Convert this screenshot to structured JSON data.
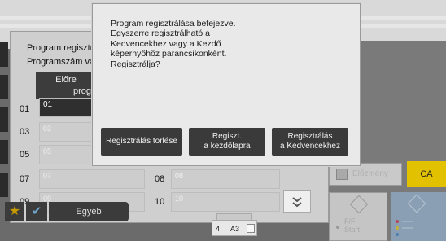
{
  "main_dialog": {
    "title_line1": "Program regisztr",
    "title_line2": "Programszám vá",
    "tab_label_line1": "Előre",
    "tab_label_line2": "prog",
    "programs": [
      {
        "number": "01",
        "field": "01"
      },
      {
        "number": "03",
        "field": "03"
      },
      {
        "number": "05",
        "field": "05"
      },
      {
        "number": "07",
        "field": "07"
      },
      {
        "number": "08",
        "field": "08"
      },
      {
        "number": "09",
        "field": "09"
      },
      {
        "number": "10",
        "field": "10"
      }
    ],
    "scroll_down_icon": "double-chevron-down-icon"
  },
  "popup": {
    "message": "Program regisztrálása befejezve.\nEgyszerre regisztrálható a\nKedvencekhez vagy a Kezdő\nképernyőhöz parancsikonként.\nRegisztrálja?",
    "buttons": {
      "cancel": "Regisztrálás törlése",
      "home": "Regiszt.\na kezdőlapra",
      "favorites": "Regisztrálás\na Kedvencekhez"
    }
  },
  "right_panel": {
    "address_label": "Előzmény",
    "ca_label": "CA",
    "bw_start_line1": "F/F",
    "bw_start_line2": "Start"
  },
  "bottom_bar": {
    "star_icon": "star-icon",
    "check_icon": "checkmark-icon",
    "other_label": "Egyéb",
    "counter_value": "4",
    "counter_paper": "A3"
  },
  "colors": {
    "popup_button_bg": "#3a3a3a",
    "ca_button": "#e2c200",
    "color_start": "#8a9fb3",
    "star": "#c79a00"
  }
}
